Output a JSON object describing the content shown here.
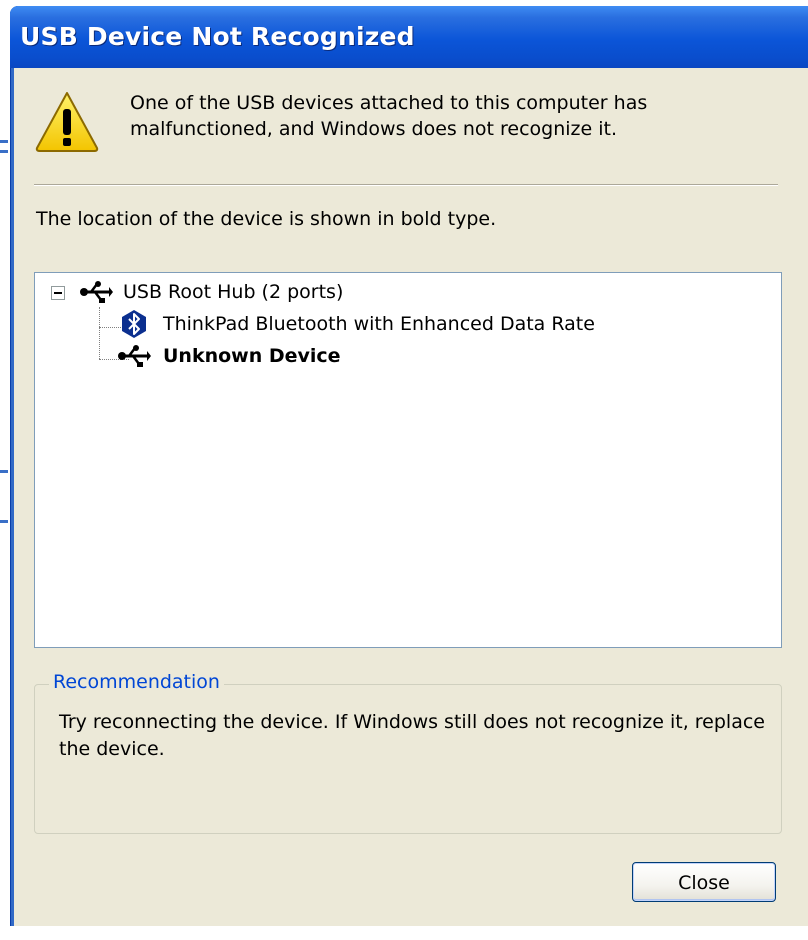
{
  "window": {
    "title": "USB Device Not Recognized"
  },
  "message": {
    "icon": "warning-icon",
    "line1": "One of the USB devices attached to this computer has",
    "line2": "malfunctioned, and Windows does not recognize it."
  },
  "location_text": "The location of the device is shown in bold type.",
  "tree": {
    "root": {
      "label": "USB Root Hub (2 ports)",
      "icon": "usb-icon",
      "expanded": true
    },
    "children": [
      {
        "label": "ThinkPad Bluetooth with Enhanced Data Rate",
        "icon": "bluetooth-icon",
        "bold": false
      },
      {
        "label": "Unknown Device",
        "icon": "usb-icon",
        "bold": true
      }
    ]
  },
  "recommendation": {
    "title": "Recommendation",
    "line1": "Try reconnecting the device. If Windows still does not recognize it, replace",
    "line2": "the device."
  },
  "buttons": {
    "close_label": "Close"
  },
  "colors": {
    "titlebar": "#0a4dcc",
    "dialog_bg": "#ece9d8",
    "group_title": "#0046d5"
  }
}
